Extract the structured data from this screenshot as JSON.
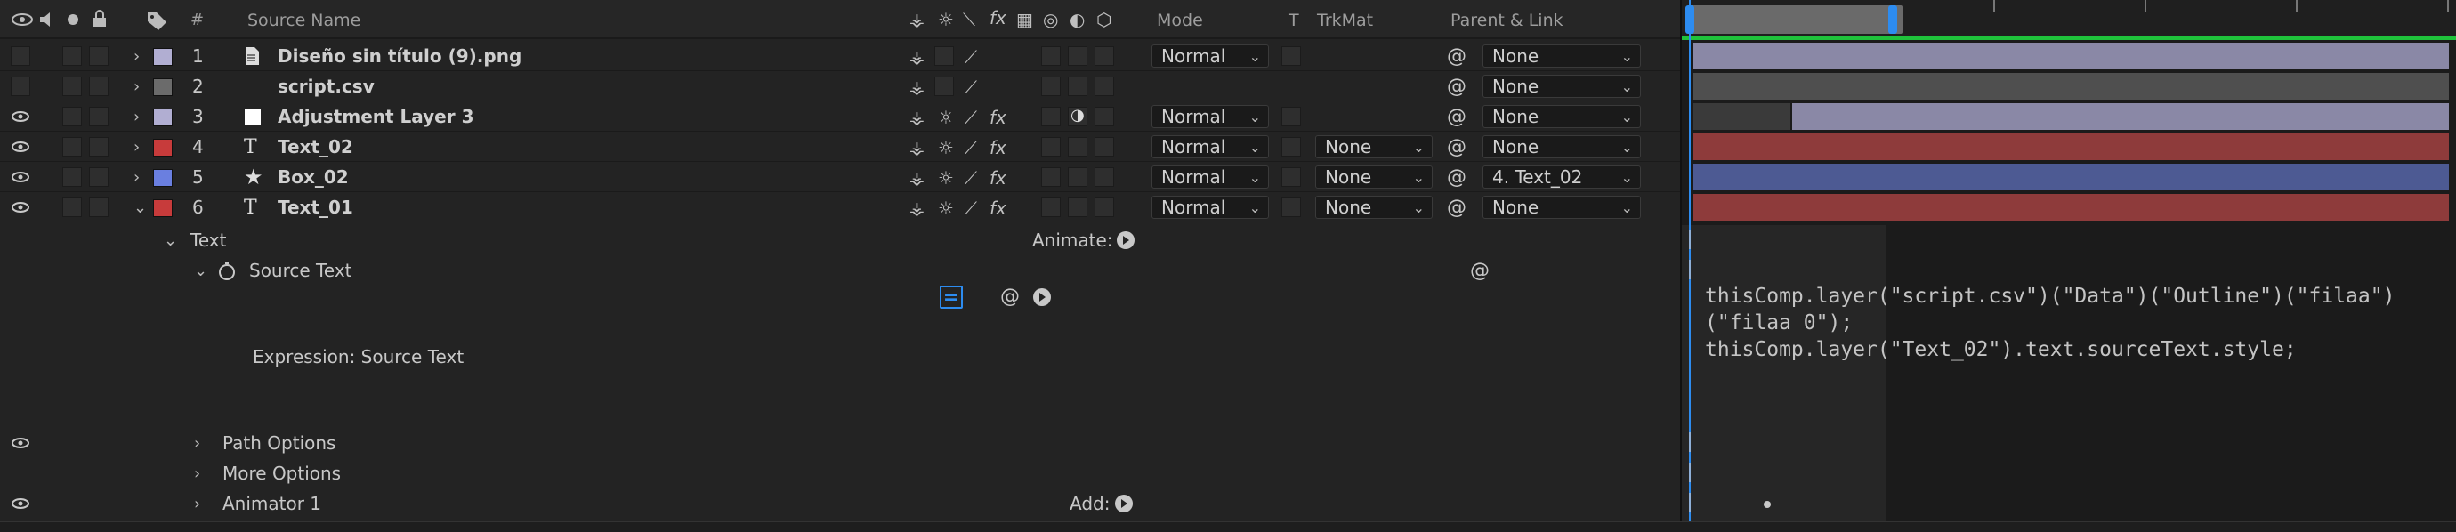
{
  "header": {
    "num_label": "#",
    "source_name_label": "Source Name",
    "mode_label": "Mode",
    "t_label": "T",
    "trkmat_label": "TrkMat",
    "parent_label": "Parent & Link",
    "switches_fx": "fx"
  },
  "layers": [
    {
      "num": "1",
      "name": "Diseño sin título (9).png",
      "color": "#b1aed2",
      "mode": "Normal",
      "trkmat": "",
      "parent": "None",
      "expanded": false
    },
    {
      "num": "2",
      "name": "script.csv",
      "color": "#6b6b6b",
      "mode": "",
      "trkmat": "",
      "parent": "None",
      "expanded": false
    },
    {
      "num": "3",
      "name": "Adjustment Layer 3",
      "color": "#b1aed2",
      "mode": "Normal",
      "trkmat": "",
      "parent": "None",
      "expanded": false
    },
    {
      "num": "4",
      "name": "Text_02",
      "color": "#c73b3b",
      "mode": "Normal",
      "trkmat": "None",
      "parent": "None",
      "expanded": false
    },
    {
      "num": "5",
      "name": "Box_02",
      "color": "#6a7fe0",
      "mode": "Normal",
      "trkmat": "None",
      "parent": "4. Text_02",
      "expanded": false
    },
    {
      "num": "6",
      "name": "Text_01",
      "color": "#c73b3b",
      "mode": "Normal",
      "trkmat": "None",
      "parent": "None",
      "expanded": true
    }
  ],
  "props": {
    "text": "Text",
    "animate": "Animate:",
    "source_text": "Source Text",
    "expression_label": "Expression: Source Text",
    "path_options": "Path Options",
    "more_options": "More Options",
    "animator": "Animator 1",
    "add": "Add:"
  },
  "expression": {
    "line1": "thisComp.layer(\"script.csv\")(\"Data\")(\"Outline\")(\"filaa\")",
    "line2": "(\"filaa 0\");",
    "line3": "thisComp.layer(\"Text_02\").text.sourceText.style;"
  },
  "colors": {
    "accent_blue": "#2d8cf0",
    "work_area_green": "#1fc33b",
    "bar_lavender": "#8a88a6",
    "bar_red": "#8e3b3b",
    "bar_blue": "#4d5a93",
    "bar_gray": "#4f4f4f"
  }
}
